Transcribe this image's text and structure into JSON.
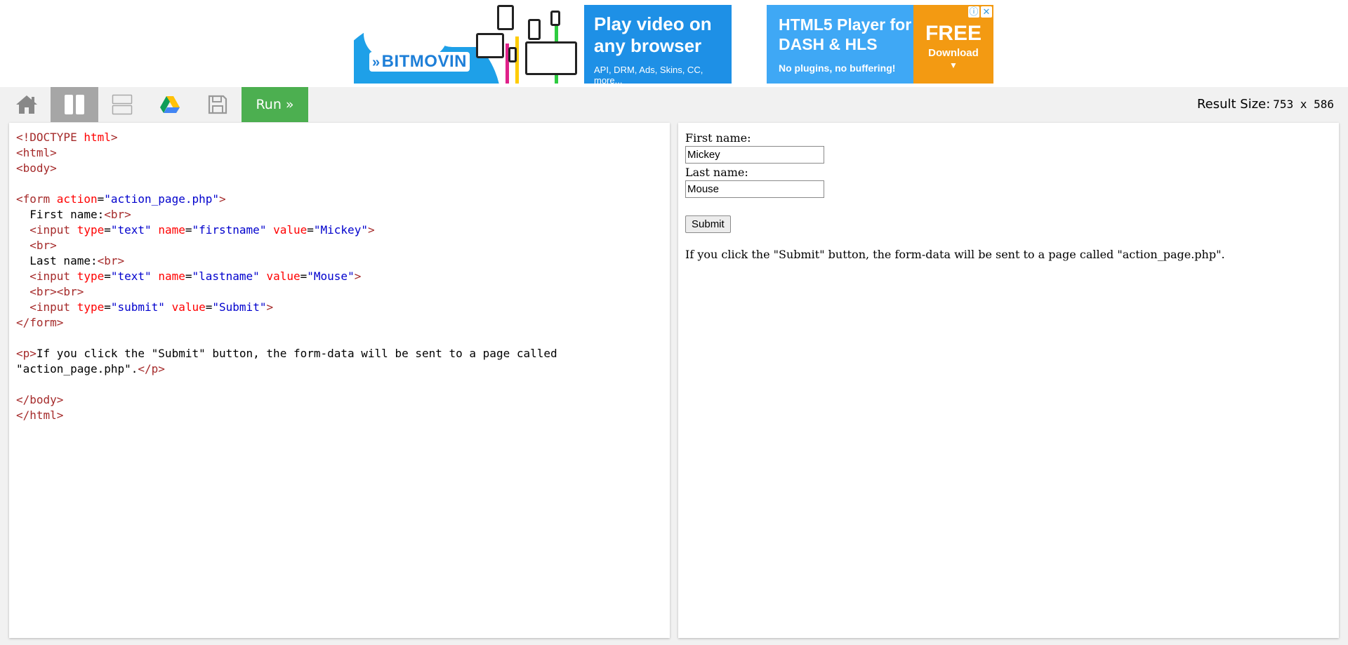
{
  "ad": {
    "brand": "BITMOVIN",
    "headline": "Play video on any browser",
    "features": "API, DRM, Ads, Skins, CC, more...",
    "product": "HTML5 Player for DASH & HLS",
    "tagline": "No plugins, no buffering!",
    "cta_title": "FREE",
    "cta_sub": "Download",
    "cta_arrow": "▼",
    "info_glyph": "ⓘ",
    "close_glyph": "✕"
  },
  "toolbar": {
    "run_label": "Run »",
    "result_size_label": "Result Size:",
    "result_size_value": "753 x 586",
    "icons": [
      "home-icon",
      "split-vertical-icon",
      "split-horizontal-icon",
      "google-drive-icon",
      "save-icon"
    ]
  },
  "editor": {
    "lines": [
      [
        {
          "c": "tg",
          "t": "<!DOCTYPE "
        },
        {
          "c": "dh",
          "t": "html"
        },
        {
          "c": "tg",
          "t": ">"
        }
      ],
      [
        {
          "c": "tg",
          "t": "<html>"
        }
      ],
      [
        {
          "c": "tg",
          "t": "<body>"
        }
      ],
      [],
      [
        {
          "c": "tg",
          "t": "<form "
        },
        {
          "c": "at",
          "t": "action"
        },
        {
          "c": "tx",
          "t": "="
        },
        {
          "c": "vl",
          "t": "\"action_page.php\""
        },
        {
          "c": "tg",
          "t": ">"
        }
      ],
      [
        {
          "c": "tx",
          "t": "  First name:"
        },
        {
          "c": "tg",
          "t": "<br>"
        }
      ],
      [
        {
          "c": "tx",
          "t": "  "
        },
        {
          "c": "tg",
          "t": "<input "
        },
        {
          "c": "at",
          "t": "type"
        },
        {
          "c": "tx",
          "t": "="
        },
        {
          "c": "vl",
          "t": "\"text\" "
        },
        {
          "c": "at",
          "t": "name"
        },
        {
          "c": "tx",
          "t": "="
        },
        {
          "c": "vl",
          "t": "\"firstname\" "
        },
        {
          "c": "at",
          "t": "value"
        },
        {
          "c": "tx",
          "t": "="
        },
        {
          "c": "vl",
          "t": "\"Mickey\""
        },
        {
          "c": "tg",
          "t": ">"
        }
      ],
      [
        {
          "c": "tx",
          "t": "  "
        },
        {
          "c": "tg",
          "t": "<br>"
        }
      ],
      [
        {
          "c": "tx",
          "t": "  Last name:"
        },
        {
          "c": "tg",
          "t": "<br>"
        }
      ],
      [
        {
          "c": "tx",
          "t": "  "
        },
        {
          "c": "tg",
          "t": "<input "
        },
        {
          "c": "at",
          "t": "type"
        },
        {
          "c": "tx",
          "t": "="
        },
        {
          "c": "vl",
          "t": "\"text\" "
        },
        {
          "c": "at",
          "t": "name"
        },
        {
          "c": "tx",
          "t": "="
        },
        {
          "c": "vl",
          "t": "\"lastname\" "
        },
        {
          "c": "at",
          "t": "value"
        },
        {
          "c": "tx",
          "t": "="
        },
        {
          "c": "vl",
          "t": "\"Mouse\""
        },
        {
          "c": "tg",
          "t": ">"
        }
      ],
      [
        {
          "c": "tx",
          "t": "  "
        },
        {
          "c": "tg",
          "t": "<br><br>"
        }
      ],
      [
        {
          "c": "tx",
          "t": "  "
        },
        {
          "c": "tg",
          "t": "<input "
        },
        {
          "c": "at",
          "t": "type"
        },
        {
          "c": "tx",
          "t": "="
        },
        {
          "c": "vl",
          "t": "\"submit\" "
        },
        {
          "c": "at",
          "t": "value"
        },
        {
          "c": "tx",
          "t": "="
        },
        {
          "c": "vl",
          "t": "\"Submit\""
        },
        {
          "c": "tg",
          "t": ">"
        }
      ],
      [
        {
          "c": "tg",
          "t": "</form>"
        }
      ],
      [],
      [
        {
          "c": "tg",
          "t": "<p>"
        },
        {
          "c": "tx",
          "t": "If you click the \"Submit\" button, the form-data will be sent to a page called"
        }
      ],
      [
        {
          "c": "tx",
          "t": "\"action_page.php\"."
        },
        {
          "c": "tg",
          "t": "</p>"
        }
      ],
      [],
      [
        {
          "c": "tg",
          "t": "</body>"
        }
      ],
      [
        {
          "c": "tg",
          "t": "</html>"
        }
      ]
    ]
  },
  "result": {
    "first_name_label": "First name:",
    "first_name_value": "Mickey",
    "last_name_label": "Last name:",
    "last_name_value": "Mouse",
    "submit_label": "Submit",
    "paragraph": "If you click the \"Submit\" button, the form-data will be sent to a page called \"action_page.php\"."
  },
  "colors": {
    "run_button": "#4caf50",
    "toolbar_bg": "#f1f1f1",
    "active_layout_bg": "#a6a6a6",
    "tag": "#a52a2a",
    "attribute": "#ff0000",
    "value": "#0000cd"
  }
}
